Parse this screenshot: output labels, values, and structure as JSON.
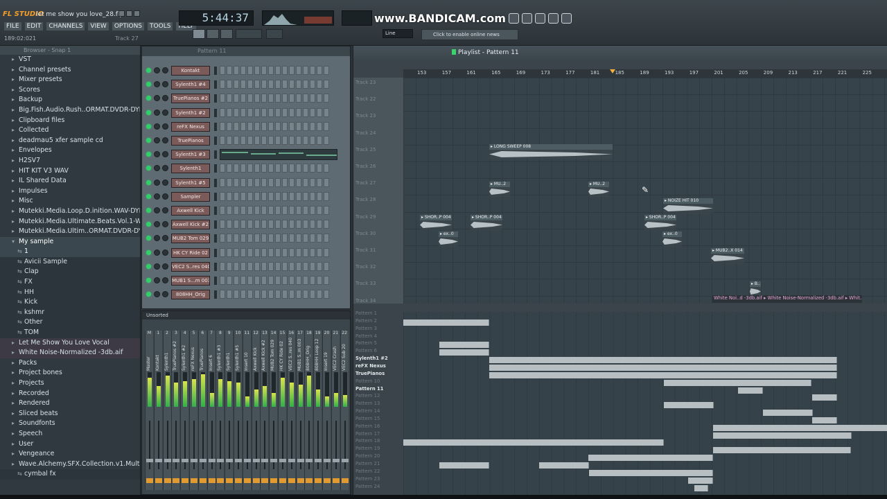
{
  "title_bar": {
    "app_name": "FL STUDIO",
    "filename": "let me show you love_28.flp"
  },
  "menu": [
    "FILE",
    "EDIT",
    "CHANNELS",
    "VIEW",
    "OPTIONS",
    "TOOLS",
    "HELP"
  ],
  "hint_text": "189:02:021",
  "hint_track": "Track 27",
  "transport": {
    "time": "5:44:37"
  },
  "watermark": "www.BANDICAM.com",
  "online_news": "Click to enable online news",
  "snap_mode": "Line",
  "browser": {
    "header": "Browser - Snap 1",
    "items": [
      {
        "label": "VST",
        "level": 1,
        "glyph": "▸"
      },
      {
        "label": "Channel presets",
        "level": 1,
        "glyph": "▸"
      },
      {
        "label": "Mixer presets",
        "level": 1,
        "glyph": "▸"
      },
      {
        "label": "Scores",
        "level": 1,
        "glyph": "▸"
      },
      {
        "label": "Backup",
        "level": 1,
        "glyph": "▸"
      },
      {
        "label": "Big.Fish.Audio.Rush..ORMAT.DVDR-DYNAMICS",
        "level": 1,
        "glyph": "▸"
      },
      {
        "label": "Clipboard files",
        "level": 1,
        "glyph": "▸"
      },
      {
        "label": "Collected",
        "level": 1,
        "glyph": "▸"
      },
      {
        "label": "deadmau5 xfer sample cd",
        "level": 1,
        "glyph": "▸"
      },
      {
        "label": "Envelopes",
        "level": 1,
        "glyph": "▸"
      },
      {
        "label": "H2SV7",
        "level": 1,
        "glyph": "▸"
      },
      {
        "label": "HIT KIT V3 WAV",
        "level": 1,
        "glyph": "▸"
      },
      {
        "label": "IL Shared Data",
        "level": 1,
        "glyph": "▸"
      },
      {
        "label": "Impulses",
        "level": 1,
        "glyph": "▸"
      },
      {
        "label": "Misc",
        "level": 1,
        "glyph": "▸"
      },
      {
        "label": "Mutekki.Media.Loop.D.inition.WAV-DYNAMICS",
        "level": 1,
        "glyph": "▸"
      },
      {
        "label": "Mutekki.Media.Ultimate.Beats.Vol.1-WAV",
        "level": 1,
        "glyph": "▸"
      },
      {
        "label": "Mutekki.Media.Ultim..ORMAT.DVDR-DYNAMICS",
        "level": 1,
        "glyph": "▸"
      },
      {
        "label": "My sample",
        "level": 1,
        "glyph": "▾",
        "selected": true
      },
      {
        "label": "1",
        "level": 2,
        "glyph": "⇆",
        "selected": true
      },
      {
        "label": "Avicii Sample",
        "level": 2,
        "glyph": "⇆"
      },
      {
        "label": "Clap",
        "level": 2,
        "glyph": "⇆"
      },
      {
        "label": "FX",
        "level": 2,
        "glyph": "⇆"
      },
      {
        "label": "HH",
        "level": 2,
        "glyph": "⇆"
      },
      {
        "label": "Kick",
        "level": 2,
        "glyph": "⇆"
      },
      {
        "label": "kshmr",
        "level": 2,
        "glyph": "⇆"
      },
      {
        "label": "Other",
        "level": 2,
        "glyph": "⇆"
      },
      {
        "label": "TOM",
        "level": 2,
        "glyph": "⇆"
      },
      {
        "label": "Let Me Show You Love Vocal",
        "level": 1,
        "glyph": "▸",
        "highlight": true
      },
      {
        "label": "White Noise-Normalized -3db.aif",
        "level": 1,
        "glyph": "▸",
        "highlight": true
      },
      {
        "label": "Packs",
        "level": 1,
        "glyph": "▸"
      },
      {
        "label": "Project bones",
        "level": 1,
        "glyph": "▸"
      },
      {
        "label": "Projects",
        "level": 1,
        "glyph": "▸"
      },
      {
        "label": "Recorded",
        "level": 1,
        "glyph": "▸"
      },
      {
        "label": "Rendered",
        "level": 1,
        "glyph": "▸"
      },
      {
        "label": "Sliced beats",
        "level": 1,
        "glyph": "▸"
      },
      {
        "label": "Soundfonts",
        "level": 1,
        "glyph": "▸"
      },
      {
        "label": "Speech",
        "level": 1,
        "glyph": "▸"
      },
      {
        "label": "User",
        "level": 1,
        "glyph": "▸"
      },
      {
        "label": "Vengeance",
        "level": 1,
        "glyph": "▸"
      },
      {
        "label": "Wave.Alchemy.SFX.Collection.v1.MultiFormat",
        "level": 1,
        "glyph": "▸"
      },
      {
        "label": "cymbal fx",
        "level": 2,
        "glyph": "⇆"
      }
    ]
  },
  "channel_rack": {
    "header": "Pattern 11",
    "channels": [
      "Kontakt",
      "Sylenth1 #4",
      "TruePianos #2",
      "Sylenth1 #2",
      "reFX Nexus",
      "TruePianos",
      "Sylenth1 #3",
      "Sylenth1",
      "Sylenth1 #5",
      "Sampler",
      "Axwell Kick",
      "Axwell Kick #2",
      "MUB2 Tom 029",
      "HK CY Ride 02",
      "VEC2 S..res 040",
      "MUB1 S...m 003",
      "808HH_Orig"
    ]
  },
  "mixer": {
    "header": "Unsorted",
    "tracks": [
      "Master",
      "Kontakt",
      "Sylenth1",
      "TruePianos #2",
      "Sylenth1 #2",
      "reFX Nexus",
      "TruePianos",
      "Insert 6",
      "Sylenth1 #3",
      "Sylenth1",
      "Sylenth1 #5",
      "Insert 10",
      "Axwell Kick",
      "Axwell Kick #2",
      "MUB2 Tom 029",
      "HK CY Ride 02",
      "VEC2 S..res 040",
      "MUB1 S..m 003",
      "808HH_Orig",
      "808HH Loop 12",
      "Insert 19",
      "VEC2 Crash",
      "VEC2 Sub 20"
    ],
    "track_numbers": [
      "M",
      "1",
      "2",
      "3",
      "4",
      "5",
      "6",
      "7",
      "8",
      "9",
      "10",
      "11",
      "12",
      "13",
      "14",
      "15",
      "16",
      "17",
      "18",
      "19",
      "20",
      "21",
      "22"
    ],
    "levels": [
      0.85,
      0.6,
      0.9,
      0.7,
      0.75,
      0.8,
      0.95,
      0.4,
      0.8,
      0.75,
      0.7,
      0.3,
      0.5,
      0.6,
      0.4,
      0.85,
      0.7,
      0.65,
      0.9,
      0.5,
      0.3,
      0.4,
      0.35
    ]
  },
  "playlist": {
    "title": "Playlist - Pattern 11",
    "ruler": [
      "153",
      "157",
      "161",
      "165",
      "169",
      "173",
      "177",
      "181",
      "185",
      "189",
      "193",
      "197",
      "201",
      "205",
      "209",
      "213",
      "217",
      "221",
      "225"
    ],
    "upper_tracks": [
      "Track 23",
      "Track 22",
      "Track 23",
      "Track 24",
      "Track 25",
      "Track 26",
      "Track 27",
      "Track 28",
      "Track 29",
      "Track 30",
      "Track 31",
      "Track 32",
      "Track 33",
      "Track 34"
    ],
    "clips": [
      {
        "label": "LONG SWEEP 008"
      },
      {
        "label": "MU..2"
      },
      {
        "label": "MU..2"
      },
      {
        "label": "NOIZE HIT 010"
      },
      {
        "label": "SHOR..P 004"
      },
      {
        "label": "SHOR..P 004"
      },
      {
        "label": "SHOR..P 004"
      },
      {
        "label": "ex..0"
      },
      {
        "label": "ex..0"
      },
      {
        "label": "MUB2..X 014"
      },
      {
        "label": "B.."
      }
    ],
    "audio_bar": "White Noi..d -3db.aif ▸ White Noise-Normalized -3db.aif ▸ Whit..#2",
    "lower_tracks": [
      {
        "label": "Pattern 1",
        "bold": false
      },
      {
        "label": "Pattern 2",
        "bold": false
      },
      {
        "label": "Pattern 3",
        "bold": false
      },
      {
        "label": "Pattern 4",
        "bold": false
      },
      {
        "label": "Pattern 5",
        "bold": false
      },
      {
        "label": "Pattern 6",
        "bold": false
      },
      {
        "label": "Sylenth1 #2",
        "bold": true
      },
      {
        "label": "reFX Nexus",
        "bold": true
      },
      {
        "label": "TruePianos",
        "bold": true
      },
      {
        "label": "Pattern 10",
        "bold": false
      },
      {
        "label": "Pattern 11",
        "bold": true
      },
      {
        "label": "Pattern 12",
        "bold": false
      },
      {
        "label": "Pattern 13",
        "bold": false
      },
      {
        "label": "Pattern 14",
        "bold": false
      },
      {
        "label": "Pattern 15",
        "bold": false
      },
      {
        "label": "Pattern 16",
        "bold": false
      },
      {
        "label": "Pattern 17",
        "bold": false
      },
      {
        "label": "Pattern 18",
        "bold": false
      },
      {
        "label": "Pattern 19",
        "bold": false
      },
      {
        "label": "Pattern 20",
        "bold": false
      },
      {
        "label": "Pattern 21",
        "bold": false
      },
      {
        "label": "Pattern 22",
        "bold": false
      },
      {
        "label": "Pattern 23",
        "bold": false
      },
      {
        "label": "Pattern 24",
        "bold": false
      }
    ]
  }
}
